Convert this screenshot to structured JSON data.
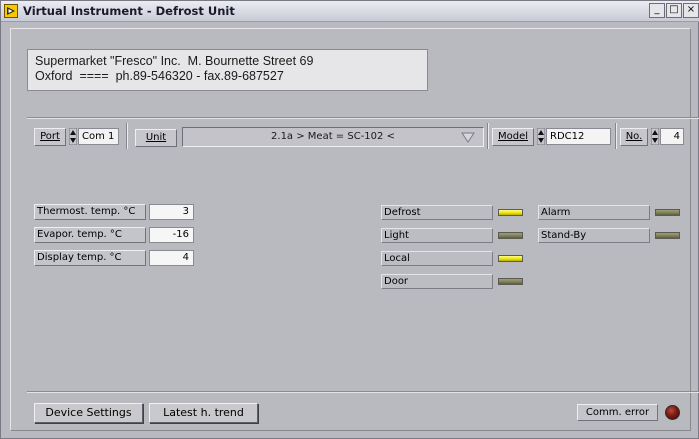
{
  "window": {
    "title": "Virtual Instrument - Defrost Unit",
    "controls": [
      "_",
      "□",
      "×"
    ]
  },
  "info": {
    "line1": "Supermarket \"Fresco\" Inc.  M. Bournette Street 69",
    "line2": "Oxford  ====  ph.89-546320 - fax.89-687527"
  },
  "toolbar": {
    "port_label": "Port",
    "port_value": "Com 1",
    "unit_label": "Unit",
    "unit_value": "2.1a > Meat = SC-102 <",
    "model_label": "Model",
    "model_value": "RDC12",
    "no_label": "No.",
    "no_value": "4"
  },
  "temps": [
    {
      "label": "Thermost. temp. °C",
      "value": "3"
    },
    {
      "label": "Evapor. temp. °C",
      "value": "-16"
    },
    {
      "label": "Display temp. °C",
      "value": "4"
    }
  ],
  "status_left": [
    {
      "label": "Defrost",
      "state": "on"
    },
    {
      "label": "Light",
      "state": "off"
    },
    {
      "label": "Local",
      "state": "on"
    },
    {
      "label": "Door",
      "state": "off"
    }
  ],
  "status_right": [
    {
      "label": "Alarm",
      "state": "off"
    },
    {
      "label": "Stand-By",
      "state": "off"
    }
  ],
  "footer": {
    "device_settings": "Device Settings",
    "latest_trend": "Latest h. trend",
    "comm_error": "Comm. error"
  },
  "colors": {
    "led_on": "#e9e20a",
    "led_off": "#7e7e5a",
    "comm_error_led": "#7a1d12",
    "panel_bg": "#b9b9c0"
  }
}
